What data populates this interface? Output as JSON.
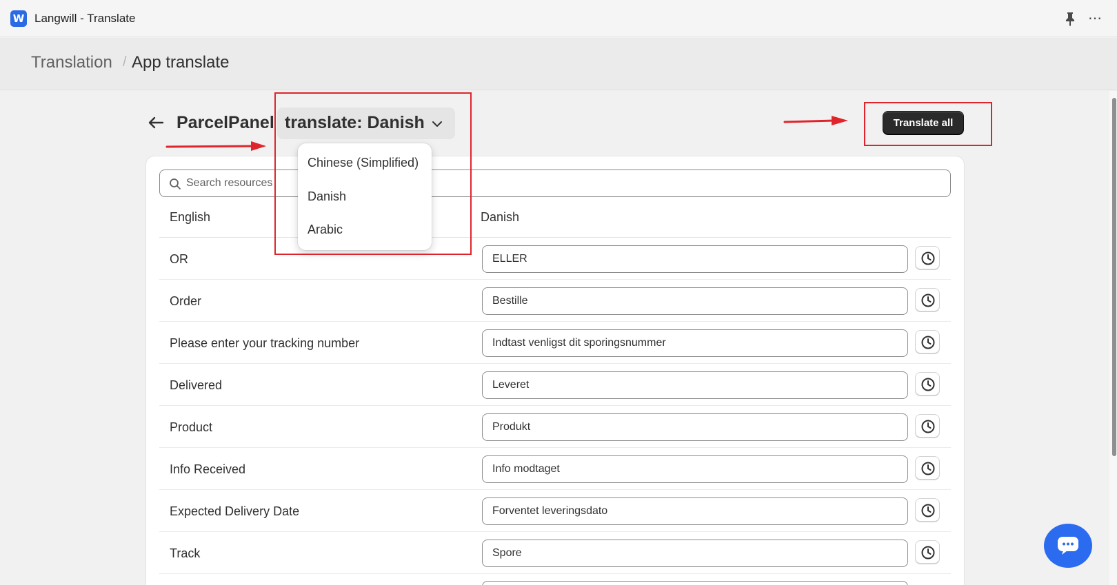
{
  "window": {
    "app_title": "Langwill - Translate",
    "logo_letter": "W",
    "icons": [
      "pin-icon",
      "more-icon"
    ]
  },
  "breadcrumb": {
    "parent": "Translation",
    "separator": "/",
    "current": "App translate"
  },
  "header": {
    "title": "ParcelPanel",
    "language_select_label": "translate: Danish",
    "translate_all_label": "Translate all"
  },
  "search": {
    "placeholder": "Search resources"
  },
  "table": {
    "columns": [
      "English",
      "Danish"
    ],
    "rows": [
      {
        "english": "OR",
        "translated": "ELLER"
      },
      {
        "english": "Order",
        "translated": "Bestille"
      },
      {
        "english": "Please enter your tracking number",
        "translated": "Indtast venligst dit sporingsnummer"
      },
      {
        "english": "Delivered",
        "translated": "Leveret"
      },
      {
        "english": "Product",
        "translated": "Produkt"
      },
      {
        "english": "Info Received",
        "translated": "Info modtaget"
      },
      {
        "english": "Expected Delivery Date",
        "translated": "Forventet leveringsdato"
      },
      {
        "english": "Track",
        "translated": "Spore"
      }
    ]
  },
  "language_dropdown": {
    "options": [
      "Chinese (Simplified)",
      "Danish",
      "Arabic"
    ],
    "selected": "Danish"
  },
  "colors": {
    "annotation": "#e0242b",
    "primary_button": "#2a2a2a",
    "chat_button": "#2a6bf0",
    "logo": "#2a6be5"
  }
}
